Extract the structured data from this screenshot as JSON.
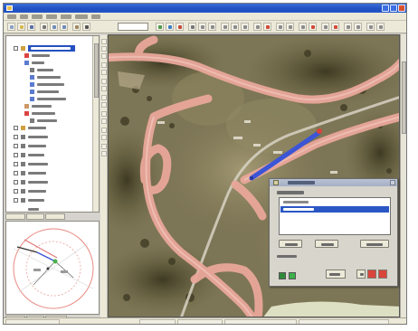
{
  "window": {
    "title": "",
    "accent": "#2456c8",
    "controls": {
      "minimize_icon": "minimize-icon",
      "maximize_icon": "maximize-icon",
      "close_icon": "close-icon"
    }
  },
  "menu": {
    "items": [
      {
        "label": ""
      },
      {
        "label": ""
      },
      {
        "label": ""
      },
      {
        "label": ""
      },
      {
        "label": ""
      },
      {
        "label": ""
      },
      {
        "label": ""
      }
    ]
  },
  "toolbar": {
    "search_value": "",
    "buttons": [
      {
        "icon": "new-icon"
      },
      {
        "icon": "open-icon"
      },
      {
        "icon": "save-icon"
      },
      {
        "icon": "print-icon"
      },
      {
        "icon": "zoom-in-icon"
      },
      {
        "icon": "zoom-out-icon"
      },
      {
        "icon": "pan-icon"
      },
      {
        "icon": "select-icon"
      },
      {
        "icon": "layer-icon"
      },
      {
        "icon": "refresh-icon"
      },
      {
        "icon": "measure-icon"
      },
      {
        "icon": "identify-icon"
      }
    ]
  },
  "layer_tree": {
    "items": [
      {
        "label": "",
        "selected": true
      },
      {
        "label": "",
        "selected": false
      },
      {
        "label": "",
        "selected": false
      },
      {
        "label": "",
        "selected": false
      },
      {
        "label": "",
        "selected": false
      },
      {
        "label": "",
        "selected": false
      },
      {
        "label": "",
        "selected": false
      },
      {
        "label": "",
        "selected": false
      },
      {
        "label": "",
        "selected": false
      },
      {
        "label": "",
        "selected": false
      },
      {
        "label": "",
        "selected": false
      },
      {
        "label": "",
        "selected": false
      },
      {
        "label": "",
        "selected": false
      },
      {
        "label": "",
        "selected": false
      },
      {
        "label": "",
        "selected": false
      },
      {
        "label": "",
        "selected": false
      },
      {
        "label": "",
        "selected": false
      },
      {
        "label": "",
        "selected": false
      },
      {
        "label": "",
        "selected": false
      },
      {
        "label": "",
        "selected": false
      },
      {
        "label": "",
        "selected": false
      }
    ],
    "tabs": [
      {
        "label": ""
      },
      {
        "label": ""
      },
      {
        "label": ""
      }
    ]
  },
  "overview": {
    "tabs": [
      {
        "label": ""
      },
      {
        "label": ""
      },
      {
        "label": ""
      }
    ]
  },
  "map": {
    "road_color": "#e9a79a",
    "route_color": "#3b55d6",
    "track_color": "#d8d2c4"
  },
  "dialog": {
    "title": "",
    "prompt_label": "",
    "list_items": [
      {
        "label": "",
        "selected": false
      },
      {
        "label": "",
        "selected": true
      },
      {
        "label": "",
        "selected": false
      },
      {
        "label": "",
        "selected": false
      },
      {
        "label": "",
        "selected": false
      }
    ],
    "buttons": [
      {
        "label": ""
      },
      {
        "label": ""
      },
      {
        "label": ""
      }
    ],
    "option_label": "",
    "swatches": [
      "#2f8a3a",
      "#3cb04a"
    ],
    "action_buttons": [
      {
        "label": ""
      },
      {
        "label": ""
      },
      {
        "label": ""
      },
      {
        "label": ""
      }
    ],
    "action_colors": [
      "#d9453a",
      "#d9453a"
    ]
  },
  "status": {
    "cells": [
      {
        "text": ""
      },
      {
        "text": ""
      },
      {
        "text": ""
      },
      {
        "text": ""
      },
      {
        "text": ""
      }
    ]
  }
}
